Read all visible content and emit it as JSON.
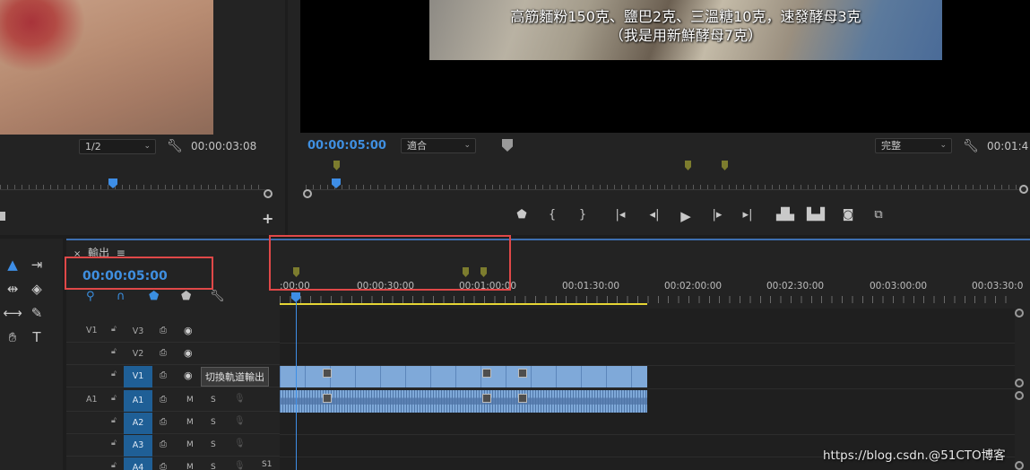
{
  "source_monitor": {
    "zoom": "1/2",
    "timecode": "00:00:03:08"
  },
  "program_monitor": {
    "subtitle_line1": "高筋麵粉150克、鹽巴2克、三溫糖10克，速發酵母3克",
    "subtitle_line2": "（我是用新鮮酵母7克）",
    "timecode": "00:00:05:00",
    "fit": "適合",
    "quality": "完整",
    "duration": "00:01:4"
  },
  "timeline": {
    "tab_close": "×",
    "tab_title": "輸出",
    "tab_menu": "≡",
    "timecode": "00:00:05:00",
    "ruler_labels": [
      ":00:00",
      "00:00:30:00",
      "00:01:00:00",
      "00:01:30:00",
      "00:02:00:00",
      "00:02:30:00",
      "00:03:00:00",
      "00:03:30:0"
    ],
    "tracks": [
      {
        "src": "V1",
        "name": "V3",
        "type": "video",
        "targeted": false
      },
      {
        "src": "",
        "name": "V2",
        "type": "video",
        "targeted": false
      },
      {
        "src": "",
        "name": "V1",
        "type": "video",
        "targeted": true
      },
      {
        "src": "A1",
        "name": "A1",
        "type": "audio",
        "targeted": true
      },
      {
        "src": "",
        "name": "A2",
        "type": "audio",
        "targeted": true
      },
      {
        "src": "",
        "name": "A3",
        "type": "audio",
        "targeted": true
      },
      {
        "src": "",
        "name": "A4",
        "type": "audio",
        "targeted": true
      }
    ],
    "mute_label": "M",
    "solo_label": "S",
    "tooltip": "切換軌道輸出",
    "last_track_extra": "S1"
  },
  "watermark": "https://blog.csdn.@51CTO博客",
  "colors": {
    "accent_blue": "#3f8fe0",
    "highlight_red": "#e04848",
    "work_area_yellow": "#e6d534",
    "clip_blue": "#7fa9d9",
    "marker_olive": "#7c7c2e"
  },
  "icons": {
    "wrench": "wrench-icon",
    "marker": "marker-shield-icon",
    "play": "play-icon",
    "camera": "camera-icon"
  }
}
